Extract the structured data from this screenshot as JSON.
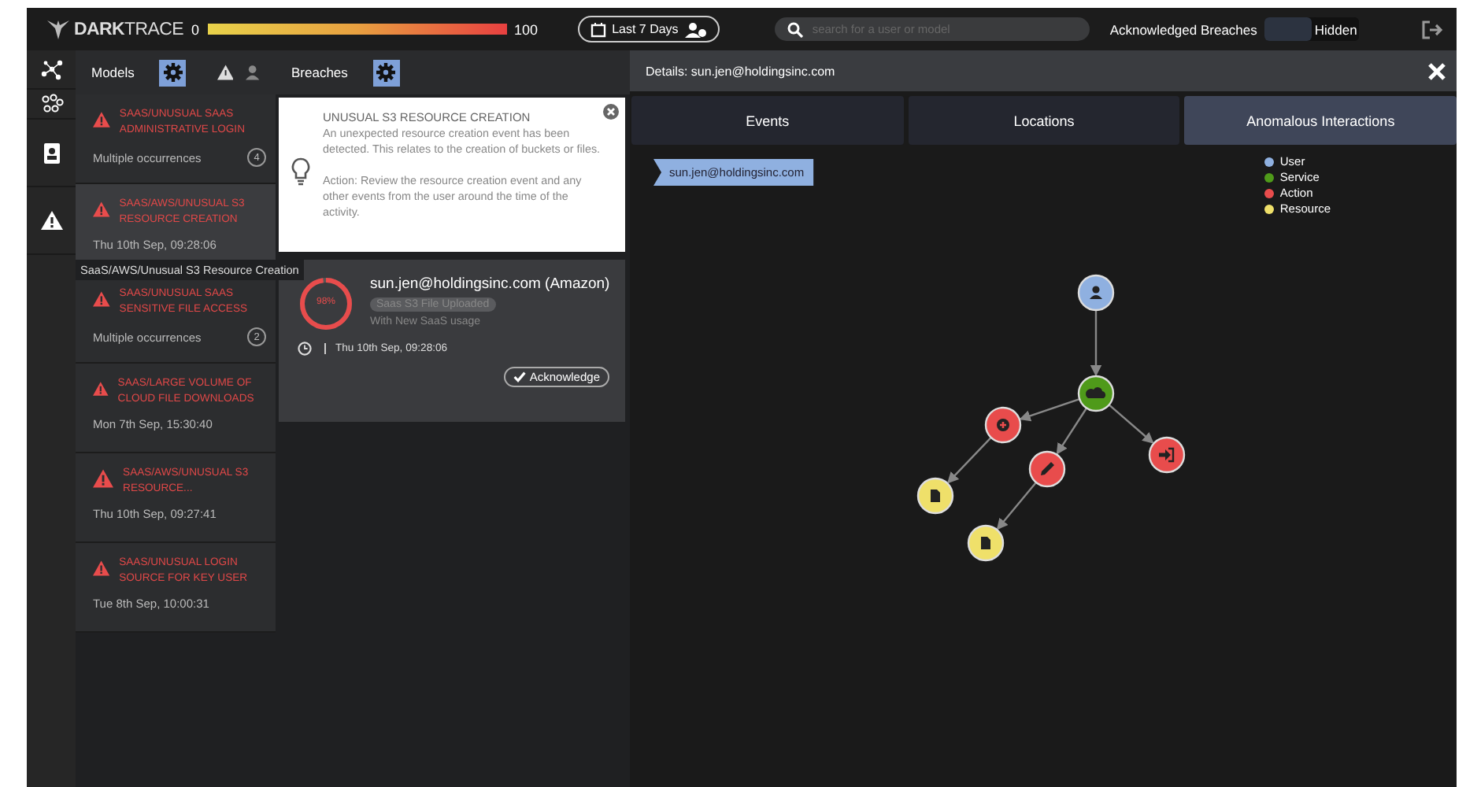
{
  "topbar": {
    "logo": "**DARK**TRACE",
    "scale_min": "0",
    "scale_max": "100",
    "range_button": "Last 7 Days",
    "search": {
      "placeholder": "search for a user or model"
    },
    "ack_label": "Acknowledged Breaches",
    "ack_options": [
      {
        "label": "Hidden",
        "selected": true
      }
    ]
  },
  "models": {
    "title": "Models",
    "items": [
      {
        "title": "SAAS/UNUSUAL SAAS ADMINISTRATIVE LOGIN",
        "subtitle": "Multiple occurrences",
        "count": "4",
        "selected": false
      },
      {
        "title": "SAAS/AWS/UNUSUAL S3 RESOURCE CREATION",
        "subtitle": "Thu 10th Sep, 09:28:06",
        "selected": true
      },
      {
        "title": "SAAS/UNUSUAL SAAS SENSITIVE FILE ACCESS",
        "subtitle": "Multiple occurrences",
        "count": "2",
        "selected": false
      },
      {
        "title": "SAAS/LARGE VOLUME OF CLOUD FILE DOWNLOADS",
        "subtitle": "Mon 7th Sep, 15:30:40",
        "selected": false
      },
      {
        "title": "SAAS/AWS/UNUSUAL S3 RESOURCE...",
        "subtitle": "Thu 10th Sep, 09:27:41",
        "selected": false
      },
      {
        "title": "SAAS/UNUSUAL LOGIN SOURCE FOR KEY USER",
        "subtitle": "Tue 8th Sep, 10:00:31",
        "selected": false
      }
    ],
    "tooltip": "SaaS/AWS/Unusual S3 Resource Creation"
  },
  "breaches": {
    "title": "Breaches",
    "info": {
      "heading": "UNUSUAL S3 RESOURCE CREATION",
      "text": "An unexpected resource creation event has been detected. This relates to the creation of buckets or files.",
      "action": "Action: Review the resource creation event and any other events from the user around the time of the activity."
    },
    "card": {
      "score": "98%",
      "level": 0.98,
      "user": "sun.jen@holdingsinc.com (Amazon)",
      "tag": "Saas S3 File Uploaded",
      "note": "With New SaaS usage",
      "time": "Thu 10th Sep, 09:28:06",
      "button": "Acknowledge"
    }
  },
  "details": {
    "title": "Details: sun.jen@holdingsinc.com",
    "tabs": [
      {
        "label": "Events",
        "selected": false
      },
      {
        "label": "Locations",
        "selected": false
      },
      {
        "label": "Anomalous Interactions",
        "selected": true
      }
    ],
    "user_tag": "sun.jen@holdingsinc.com",
    "legend": [
      {
        "label": "User",
        "color": "#8fb0e0"
      },
      {
        "label": "Service",
        "color": "#4f9a1a"
      },
      {
        "label": "Action",
        "color": "#e84c4c"
      },
      {
        "label": "Resource",
        "color": "#efe06a"
      }
    ],
    "nodes": [
      {
        "kind": "user"
      },
      {
        "kind": "service"
      },
      {
        "kind": "action"
      },
      {
        "kind": "action"
      },
      {
        "kind": "action"
      },
      {
        "kind": "resource"
      },
      {
        "kind": "resource"
      }
    ]
  }
}
